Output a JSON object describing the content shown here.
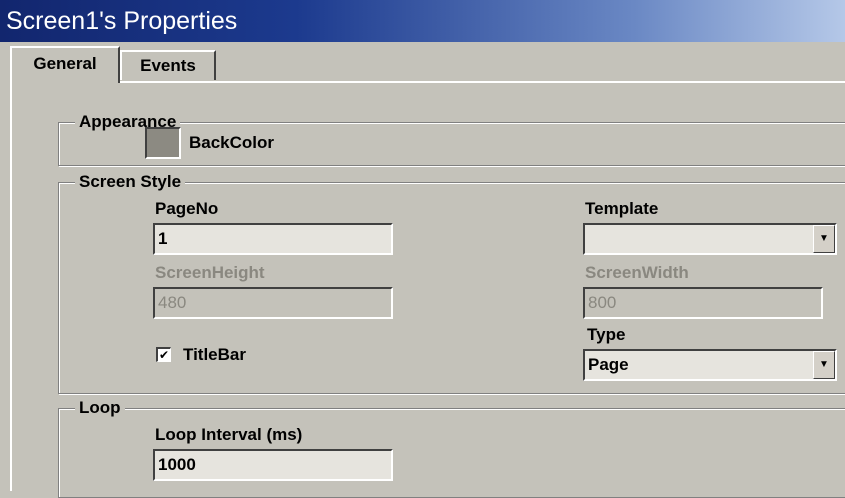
{
  "window": {
    "title": "Screen1's Properties"
  },
  "tabs": [
    {
      "label": "General"
    },
    {
      "label": "Events"
    }
  ],
  "appearance": {
    "legend": "Appearance",
    "backcolor_label": "BackColor",
    "backcolor_value": "#8c8a82"
  },
  "screen_style": {
    "legend": "Screen Style",
    "pageno_label": "PageNo",
    "pageno_value": "1",
    "template_label": "Template",
    "template_value": "",
    "screen_height_label": "ScreenHeight",
    "screen_height_value": "480",
    "screen_width_label": "ScreenWidth",
    "screen_width_value": "800",
    "titlebar_label": "TitleBar",
    "titlebar_checked": true,
    "type_label": "Type",
    "type_value": "Page"
  },
  "loop": {
    "legend": "Loop",
    "interval_label": "Loop Interval (ms)",
    "interval_value": "1000"
  },
  "icons": {
    "dropdown": "chevron-down-icon",
    "check": "checkmark-icon"
  }
}
